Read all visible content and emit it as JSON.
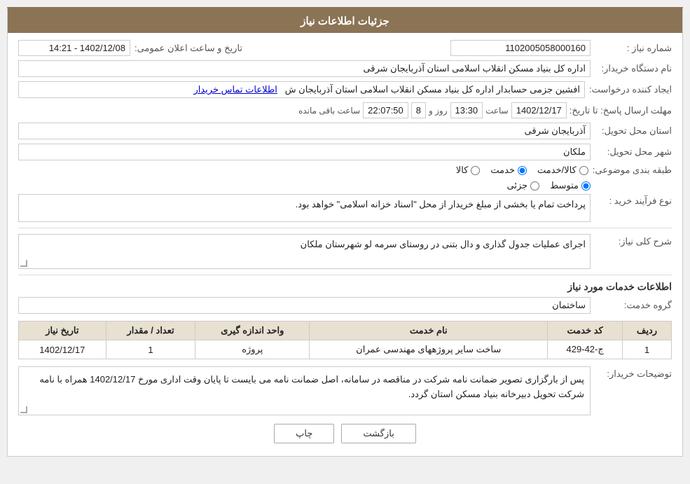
{
  "header": {
    "title": "جزئیات اطلاعات نیاز"
  },
  "fields": {
    "need_number_label": "شماره نیاز :",
    "need_number_value": "1102005058000160",
    "announcement_label": "تاریخ و ساعت اعلان عمومی:",
    "announcement_value": "1402/12/08 - 14:21",
    "buyer_name_label": "نام دستگاه خریدار:",
    "buyer_name_value": "اداره کل بنیاد مسکن انقلاب اسلامی استان آذربایجان شرقی",
    "creator_label": "ایجاد کننده درخواست:",
    "creator_value": "افشین جزمی حسابدار اداره کل بنیاد مسکن انقلاب اسلامی استان آذربایجان ش",
    "contact_link": "اطلاعات تماس خریدار",
    "deadline_label": "مهلت ارسال پاسخ: تا تاریخ:",
    "deadline_date": "1402/12/17",
    "deadline_time_label": "ساعت",
    "deadline_time": "13:30",
    "deadline_day_label": "روز و",
    "deadline_day": "8",
    "deadline_remaining_label": "ساعت باقی مانده",
    "deadline_remaining": "22:07:50",
    "province_label": "استان محل تحویل:",
    "province_value": "آذربایجان شرقی",
    "city_label": "شهر محل تحویل:",
    "city_value": "ملکان",
    "category_label": "طبقه بندی موضوعی:",
    "category_options": [
      {
        "label": "کالا",
        "value": "kala"
      },
      {
        "label": "خدمت",
        "value": "khedmat"
      },
      {
        "label": "کالا/خدمت",
        "value": "kala_khedmat"
      }
    ],
    "category_selected": "khedmat",
    "process_label": "نوع فرآیند خرید :",
    "process_options": [
      {
        "label": "جزئی",
        "value": "jozi"
      },
      {
        "label": "متوسط",
        "value": "motavaset"
      }
    ],
    "process_selected": "motavaset",
    "process_notice": "پرداخت تمام یا بخشی از مبلغ خریدار از محل \"اسناد خزانه اسلامی\" خواهد بود.",
    "general_desc_label": "شرح کلی نیاز:",
    "general_desc_value": "اجرای عملیات جدول گذاری و دال بتنی در روستای سرمه لو شهرستان ملکان",
    "services_title": "اطلاعات خدمات مورد نیاز",
    "service_group_label": "گروه خدمت:",
    "service_group_value": "ساختمان",
    "table": {
      "headers": [
        "ردیف",
        "کد خدمت",
        "نام خدمت",
        "واحد اندازه گیری",
        "تعداد / مقدار",
        "تاریخ نیاز"
      ],
      "rows": [
        {
          "row": "1",
          "code": "ج-42-429",
          "name": "ساخت سایر پروژههای مهندسی عمران",
          "unit": "پروژه",
          "quantity": "1",
          "date": "1402/12/17"
        }
      ]
    },
    "buyer_notes_label": "توضیحات خریدار:",
    "buyer_notes_value": "پس از بارگزاری تصویر ضمانت نامه شرکت در مناقصه در سامانه، اصل ضمانت نامه می بایست تا پایان وقت اداری مورخ 1402/12/17 همراه با نامه شرکت تحویل دبیرخانه بنیاد مسکن استان گردد."
  },
  "buttons": {
    "back_label": "بازگشت",
    "print_label": "چاپ"
  }
}
